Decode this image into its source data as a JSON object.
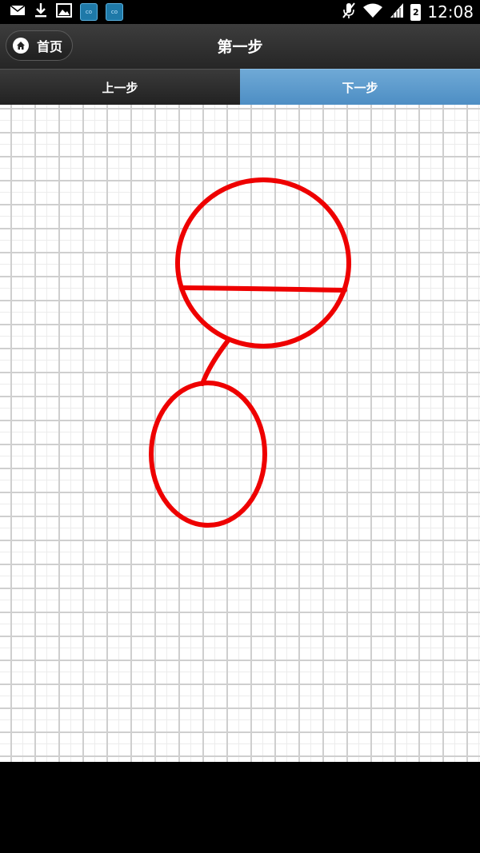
{
  "status_bar": {
    "time": "12:08",
    "battery_level": "2",
    "left_icons": [
      "mail-icon",
      "download-icon",
      "image-icon",
      "app-icon-1",
      "app-icon-2"
    ],
    "right_icons": [
      "mute-icon",
      "wifi-icon",
      "signal-icon",
      "battery-icon"
    ]
  },
  "header": {
    "home_label": "首页",
    "title": "第一步"
  },
  "tabs": {
    "prev_label": "上一步",
    "next_label": "下一步"
  },
  "drawing": {
    "stroke_color": "#ee0000",
    "grid_major_color": "#cfcfcf",
    "grid_minor_color": "#ececec"
  },
  "colors": {
    "header_bg": "#2e2e2e",
    "tab_active": "#5e9dcf"
  }
}
